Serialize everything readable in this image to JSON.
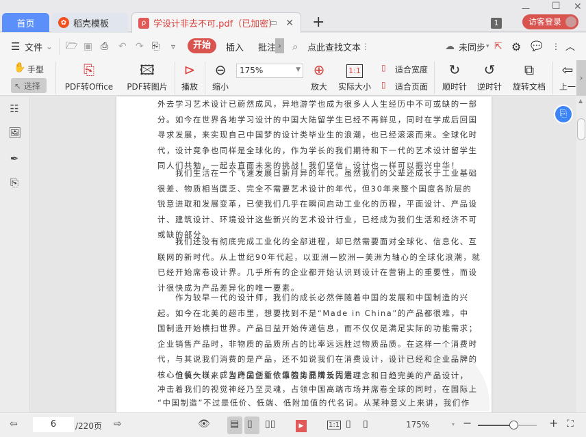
{
  "tabs": {
    "home": "首页",
    "daoke": "稻壳模板",
    "pdf": "学设计非去不可.pdf（已加密）",
    "new_tab": "+",
    "tab_count": "1",
    "login": "访客登录"
  },
  "window": {
    "minimize": "—",
    "maximize": "☐",
    "close": "✕"
  },
  "toolbar": {
    "file": "文件",
    "start": "开始",
    "insert": "插入",
    "annotate": "批注",
    "search_placeholder": "点此查找文本",
    "sync": "未同步"
  },
  "ribbon": {
    "hand": "手型",
    "select": "选择",
    "pdf_to_office": "PDF转Office",
    "pdf_to_image": "PDF转图片",
    "play": "播放",
    "zoom_out": "缩小",
    "zoom_value": "175%",
    "zoom_in": "放大",
    "actual_size": "实际大小",
    "fit_width": "适合宽度",
    "fit_page": "适合页面",
    "clockwise": "顺时针",
    "counterclockwise": "逆时针",
    "rotate_doc": "旋转文档",
    "prev": "上一"
  },
  "document": {
    "paragraphs": [
      [
        "外去学习艺术设计已蔚然成风，异地游学也成为很多人人生经历中不可或缺的一部",
        "分。如今在世界各地学习设计的中国大陆留学生已经不再鲜见，同时在学成后回国",
        "寻求发展，来实现自己中国梦的设计类毕业生的浪潮，也已经滚滚而来。全球化时",
        "代，设计竞争也同样是全球化的，作为学长的我们期待和下一代的艺术设计留学生",
        "同人们共勉，一起去直面未来的挑战！我们坚信，设计也一样可以振兴中华！"
      ],
      [
        "　　我们生活在一个飞速发展日新月异的年代。虽然我们的父辈还成长于工业基础",
        "很差、物质相当匮乏、完全不需要艺术设计的年代，但30年来整个国度各阶层的",
        "锐意进取和发展变革，已使我们几乎在瞬间启动工业化的历程，平面设计、产品设",
        "计、建筑设计、环境设计这些新兴的艺术设计行业，已经成为我们生活和经济不可",
        "或缺的部分。"
      ],
      [
        "　　我们还没有彻底完成工业化的全部进程，却已然需要面对全球化、信息化、互",
        "联网的新时代。从上世纪90年代起，以亚洲—欧洲—美洲为轴心的全球化浪潮，就",
        "已经开始席卷设计界。几乎所有的企业都开始认识到设计在营销上的重要性，而设",
        "计很快成为产品差异化的唯一要素。"
      ],
      [
        "　　作为较早一代的设计师，我们的成长必然伴随着中国的发展和中国制造的兴",
        "起。如今在北美的超市里，想要找到不是“Made in China”的产品都很难，中",
        "国制造开始横扫世界。产品日益开始传递信息，而不仅仅是满足实际的功能需求；",
        "企业销售产品时，非物质的品质所占的比率远远胜过物质品质。在这样一个消费时",
        "代，与其说我们消费的是产品，还不如说我们在消费设计，设计已经和企业品牌的",
        "核心价值一样，成为产品创新价值的主要增长因素。"
      ],
      [
        "　　但长久以来，当跨国企业依靠强势品牌及先进理念和日趋完美的产品设计，",
        "冲击着我们的视觉神经乃至灵魂，占领中国高端市场并席卷全球的同时，在国际上",
        "“中国制造”不过是低价、低端、低附加值的代名词。从某种意义上来讲，我们作"
      ]
    ]
  },
  "statusbar": {
    "page_current": "6",
    "page_total": "/220页",
    "zoom": "175%",
    "zoom_fraction": 0.6
  },
  "colors": {
    "accent_blue": "#5b8ff9",
    "brand_red": "#d9413d"
  }
}
